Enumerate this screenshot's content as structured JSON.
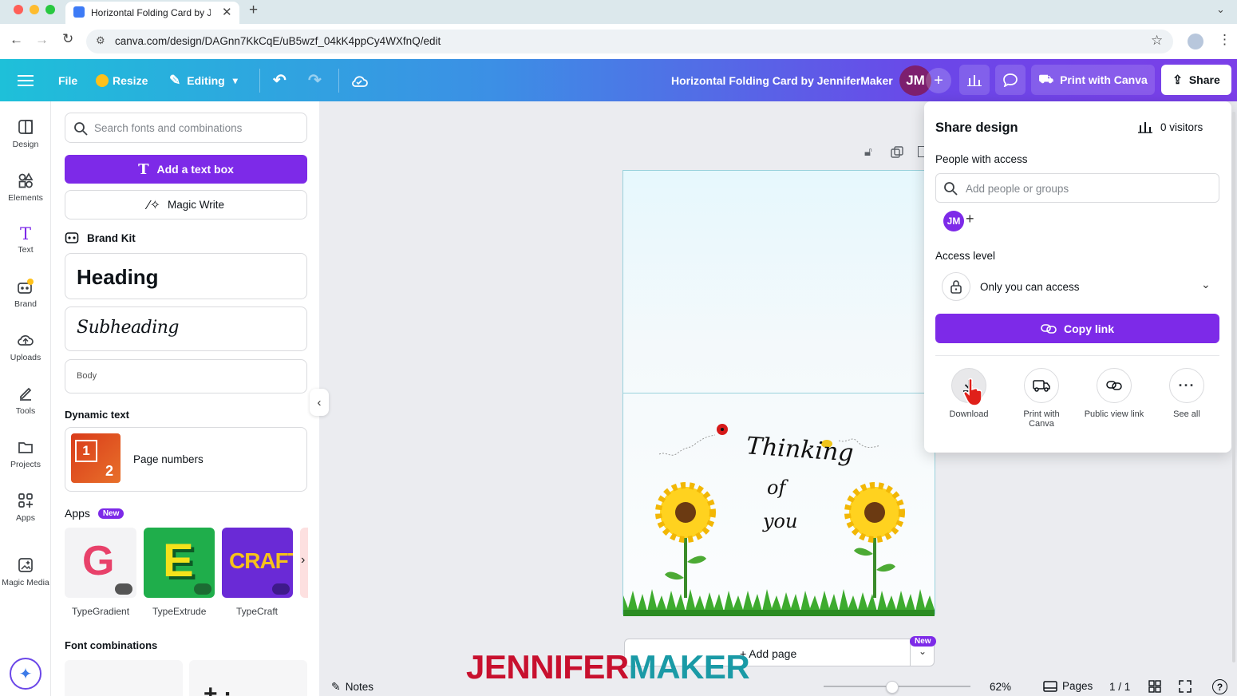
{
  "browser": {
    "tab_title": "Horizontal Folding Card by Je",
    "url": "canva.com/design/DAGnn7KkCqE/uB5wzf_04kK4ppCy4WXfnQ/edit"
  },
  "toolbar": {
    "file": "File",
    "resize": "Resize",
    "editing": "Editing",
    "doc_title": "Horizontal Folding Card by JenniferMaker",
    "avatar": "JM",
    "print_with_canva": "Print with Canva",
    "share": "Share"
  },
  "rail": [
    {
      "label": "Design",
      "icon": "design-icon"
    },
    {
      "label": "Elements",
      "icon": "elements-icon"
    },
    {
      "label": "Text",
      "icon": "text-icon"
    },
    {
      "label": "Brand",
      "icon": "brand-icon"
    },
    {
      "label": "Uploads",
      "icon": "uploads-icon"
    },
    {
      "label": "Tools",
      "icon": "tools-icon"
    },
    {
      "label": "Projects",
      "icon": "projects-icon"
    },
    {
      "label": "Apps",
      "icon": "apps-icon"
    },
    {
      "label": "Magic Media",
      "icon": "magic-media-icon"
    }
  ],
  "panel": {
    "search_placeholder": "Search fonts and combinations",
    "add_text_box": "Add a text box",
    "magic_write": "Magic Write",
    "brand_kit": "Brand Kit",
    "heading": "Heading",
    "subheading": "Subheading",
    "body": "Body",
    "dynamic_text": "Dynamic text",
    "page_numbers": "Page numbers",
    "apps": "Apps",
    "apps_badge": "New",
    "app_items": [
      {
        "label": "TypeGradient"
      },
      {
        "label": "TypeExtrude"
      },
      {
        "label": "TypeCraft"
      }
    ],
    "font_combinations": "Font combinations"
  },
  "card": {
    "line1": "Thinking",
    "line2": "of",
    "line3": "you"
  },
  "share": {
    "title": "Share design",
    "visitors": "0 visitors",
    "people_with_access": "People with access",
    "add_people_placeholder": "Add people or groups",
    "avatar": "JM",
    "access_level": "Access level",
    "access_value": "Only you can access",
    "copy_link": "Copy link",
    "options": [
      {
        "label": "Download",
        "icon": "download-icon"
      },
      {
        "label": "Print with Canva",
        "icon": "truck-icon"
      },
      {
        "label": "Public view link",
        "icon": "link-icon"
      },
      {
        "label": "See all",
        "icon": "more-icon"
      }
    ]
  },
  "canvas": {
    "add_page": "+ Add page",
    "new_badge": "New"
  },
  "bottom": {
    "notes": "Notes",
    "zoom": "62%",
    "pages": "Pages",
    "page_count": "1 / 1",
    "zoom_fraction": 0.47
  },
  "watermark": "JENNIFERMAKER",
  "colors": {
    "purple": "#7d2ae8",
    "cyan_grad_start": "#1ec0d9",
    "watermark_red": "#c8102e",
    "watermark_teal": "#1a9aa6"
  }
}
